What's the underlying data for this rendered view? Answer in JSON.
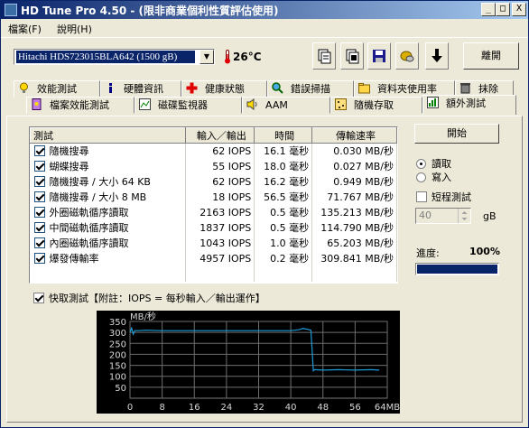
{
  "window": {
    "title": "HD Tune Pro 4.50 - (限非商業個利性質評估使用)",
    "minimize": "_",
    "maximize": "□",
    "close": "X"
  },
  "menu": [
    "檔案(F)",
    "說明(H)"
  ],
  "toolbar": {
    "drive": "Hitachi HDS723015BLA642 (1500 gB)",
    "temperature": "26°C",
    "exit_label": "離開",
    "icons": [
      "copy-info-icon",
      "copy-all-icon",
      "save-icon",
      "screenshot-icon",
      "download-icon"
    ]
  },
  "tabs_row1": [
    {
      "label": "效能測試",
      "icon": "benchmark-icon"
    },
    {
      "label": "硬體資訊",
      "icon": "info-icon"
    },
    {
      "label": "健康狀態",
      "icon": "health-icon"
    },
    {
      "label": "錯誤掃描",
      "icon": "error-scan-icon"
    },
    {
      "label": "資料夾使用率",
      "icon": "folder-icon"
    },
    {
      "label": "抹除",
      "icon": "erase-icon"
    }
  ],
  "tabs_row2": [
    {
      "label": "檔案效能測試",
      "icon": "file-bench-icon"
    },
    {
      "label": "磁碟監視器",
      "icon": "monitor-icon"
    },
    {
      "label": "AAM",
      "icon": "aam-icon"
    },
    {
      "label": "隨機存取",
      "icon": "random-icon"
    },
    {
      "label": "額外測試",
      "icon": "extra-icon",
      "active": true
    }
  ],
  "table": {
    "headers": [
      "測試",
      "輸入／輸出",
      "時間",
      "傳輸速率"
    ],
    "rows": [
      {
        "test": "隨機搜尋",
        "iops": "62 IOPS",
        "time": "16.1 毫秒",
        "rate": "0.030 MB/秒"
      },
      {
        "test": "蝴蝶搜尋",
        "iops": "55 IOPS",
        "time": "18.0 毫秒",
        "rate": "0.027 MB/秒"
      },
      {
        "test": "隨機搜尋 / 大小 64 KB",
        "iops": "62 IOPS",
        "time": "16.2 毫秒",
        "rate": "0.949 MB/秒"
      },
      {
        "test": "隨機搜尋 / 大小 8 MB",
        "iops": "18 IOPS",
        "time": "56.5 毫秒",
        "rate": "71.767 MB/秒"
      },
      {
        "test": "外圈磁軌循序讀取",
        "iops": "2163 IOPS",
        "time": "0.5 毫秒",
        "rate": "135.213 MB/秒"
      },
      {
        "test": "中間磁軌循序讀取",
        "iops": "1837 IOPS",
        "time": "0.5 毫秒",
        "rate": "114.790 MB/秒"
      },
      {
        "test": "內圈磁軌循序讀取",
        "iops": "1043 IOPS",
        "time": "1.0 毫秒",
        "rate": "65.203 MB/秒"
      },
      {
        "test": "爆發傳輸率",
        "iops": "4957 IOPS",
        "time": "0.2 毫秒",
        "rate": "309.841 MB/秒"
      }
    ]
  },
  "controls": {
    "start_label": "開始",
    "read_label": "讀取",
    "write_label": "寫入",
    "short_test_label": "短程測試",
    "size_value": "40",
    "size_unit": "gB",
    "progress_label": "進度:",
    "progress_value": "100%",
    "progress_fraction": 1.0
  },
  "quick_test_label": "快取測試【附註：IOPS = 每秒輸入／輸出運作】",
  "chart_data": {
    "type": "line",
    "ylabel": "MB/秒",
    "xlabel": "",
    "x_ticks": [
      "0",
      "8",
      "16",
      "24",
      "32",
      "40",
      "48",
      "56",
      "64MB"
    ],
    "y_ticks": [
      "350",
      "300",
      "250",
      "200",
      "150",
      "100",
      "50"
    ],
    "xlim": [
      0,
      64
    ],
    "ylim": [
      0,
      350
    ],
    "grid": true,
    "series": [
      {
        "color": "#1e9bd7",
        "x": [
          0,
          0.4,
          0.8,
          1.2,
          2,
          4,
          8,
          12,
          16,
          20,
          24,
          28,
          32,
          36,
          40,
          42,
          43,
          44,
          45,
          45.6,
          46,
          48,
          52,
          56,
          60,
          62
        ],
        "y": [
          300,
          320,
          292,
          308,
          308,
          310,
          308,
          308,
          308,
          308,
          308,
          308,
          308,
          308,
          308,
          312,
          318,
          315,
          310,
          125,
          130,
          128,
          130,
          128,
          130,
          128
        ]
      }
    ]
  }
}
